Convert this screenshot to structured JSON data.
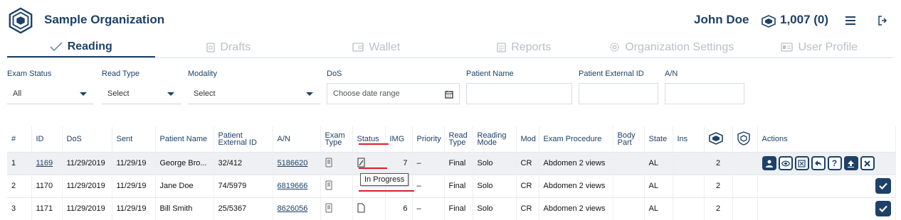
{
  "header": {
    "org_name": "Sample Organization",
    "user_name": "John Doe",
    "credits": "1,007 (0)",
    "icons": [
      "org-logo-icon",
      "credits-icon",
      "hamburger-menu-icon",
      "logout-icon"
    ]
  },
  "tabs": [
    {
      "label": "Reading",
      "icon": "checkmark-icon",
      "active": true
    },
    {
      "label": "Drafts",
      "icon": "drafts-icon",
      "active": false
    },
    {
      "label": "Wallet",
      "icon": "wallet-icon",
      "active": false
    },
    {
      "label": "Reports",
      "icon": "reports-icon",
      "active": false
    },
    {
      "label": "Organization Settings",
      "icon": "gear-icon",
      "active": false
    },
    {
      "label": "User Profile",
      "icon": "id-card-icon",
      "active": false
    }
  ],
  "filters": {
    "exam_status": {
      "label": "Exam Status",
      "value": "All"
    },
    "read_type": {
      "label": "Read Type",
      "value": "Select"
    },
    "modality": {
      "label": "Modality",
      "value": "Select"
    },
    "dos": {
      "label": "DoS",
      "placeholder": "Choose date range"
    },
    "patient_name": {
      "label": "Patient Name",
      "value": ""
    },
    "patient_external_id": {
      "label": "Patient External ID",
      "value": ""
    },
    "an": {
      "label": "A/N",
      "value": ""
    }
  },
  "table": {
    "headers": {
      "num": "#",
      "id": "ID",
      "dos": "DoS",
      "sent": "Sent",
      "patient_name": "Patient Name",
      "ext_id_1": "Patient",
      "ext_id_2": "External ID",
      "an": "A/N",
      "exam_type_1": "Exam",
      "exam_type_2": "Type",
      "status": "Status",
      "img": "IMG",
      "priority": "Priority",
      "read_type_1": "Read",
      "read_type_2": "Type",
      "reading_mode_1": "Reading",
      "reading_mode_2": "Mode",
      "mod": "Mod",
      "exam_procedure": "Exam Procedure",
      "body_part_1": "Body",
      "body_part_2": "Part",
      "state": "State",
      "ins": "Ins",
      "actions": "Actions"
    },
    "rows": [
      {
        "num": "1",
        "id": "1169",
        "dos": "11/29/2019",
        "sent": "11/29/19",
        "patient_name": "George Bro...",
        "ext_id": "32/412",
        "an": "5186620",
        "img": "7",
        "priority": "–",
        "read_type": "Final",
        "reading_mode": "Solo",
        "mod": "CR",
        "procedure": "Abdomen 2 views",
        "body_part": "",
        "state": "AL",
        "ins": "",
        "count": "2"
      },
      {
        "num": "2",
        "id": "1170",
        "dos": "11/29/2019",
        "sent": "11/29/19",
        "patient_name": "Jane Doe",
        "ext_id": "74/5979",
        "an": "6819666",
        "img": "",
        "priority": "–",
        "read_type": "Final",
        "reading_mode": "Solo",
        "mod": "CR",
        "procedure": "Abdomen 2 views",
        "body_part": "",
        "state": "AL",
        "ins": "",
        "count": "2"
      },
      {
        "num": "3",
        "id": "1171",
        "dos": "11/29/2019",
        "sent": "11/29/19",
        "patient_name": "Bill Smith",
        "ext_id": "25/5367",
        "an": "8626056",
        "img": "6",
        "priority": "–",
        "read_type": "Final",
        "reading_mode": "Solo",
        "mod": "CR",
        "procedure": "Abdomen 2 views",
        "body_part": "",
        "state": "AL",
        "ins": "",
        "count": "2"
      }
    ]
  },
  "tooltip": "In Progress",
  "colors": {
    "primary": "#1d4168",
    "annotation": "#d8202a",
    "muted": "#b8c0c8"
  }
}
